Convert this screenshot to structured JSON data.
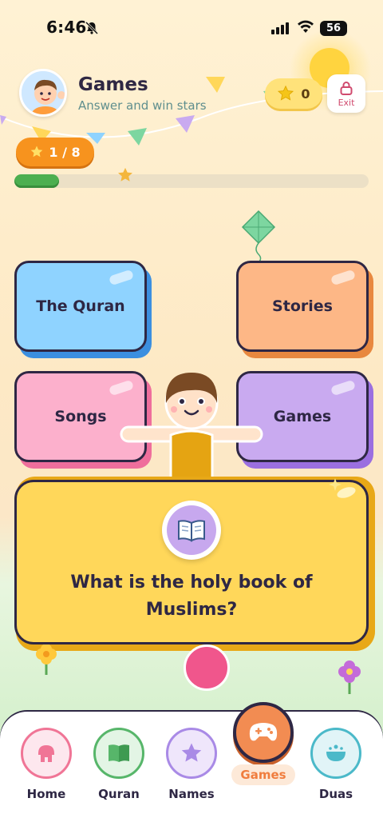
{
  "status_bar": {
    "time": "6:46",
    "battery": "56",
    "icons": [
      "bell-off-icon",
      "signal-icon",
      "wifi-icon",
      "battery-icon"
    ]
  },
  "header": {
    "title": "Games",
    "subtitle": "Answer and win stars",
    "stars_count": "0",
    "exit_label": "Exit"
  },
  "level": {
    "label": "1 / 8",
    "progress": 0.125
  },
  "options": [
    {
      "label": "The Quran",
      "color": "#8fd3ff",
      "shadow": "#3b8fe0"
    },
    {
      "label": "Stories",
      "color": "#fdb786",
      "shadow": "#e8883f"
    },
    {
      "label": "Songs",
      "color": "#fcb0cc",
      "shadow": "#ef6e9c"
    },
    {
      "label": "Games",
      "color": "#c9aaf0",
      "shadow": "#9b6fe0"
    }
  ],
  "question": {
    "text": "What is the holy book of Muslims?",
    "icon": "open-book-icon"
  },
  "nav": {
    "items": [
      {
        "label": "Home",
        "icon": "home-icon",
        "color": "#f07596",
        "bg": "#fde7ee"
      },
      {
        "label": "Quran",
        "icon": "book-icon",
        "color": "#57b66a",
        "bg": "#e3f5e5"
      },
      {
        "label": "Names",
        "icon": "star-icon",
        "color": "#a98ae6",
        "bg": "#efe6fb"
      },
      {
        "label": "Games",
        "icon": "gamepad-icon",
        "color": "#f28c52",
        "bg": "#fde9d8",
        "active": true
      },
      {
        "label": "Duas",
        "icon": "duas-icon",
        "color": "#4bb9c9",
        "bg": "#e1f4f7"
      }
    ]
  }
}
